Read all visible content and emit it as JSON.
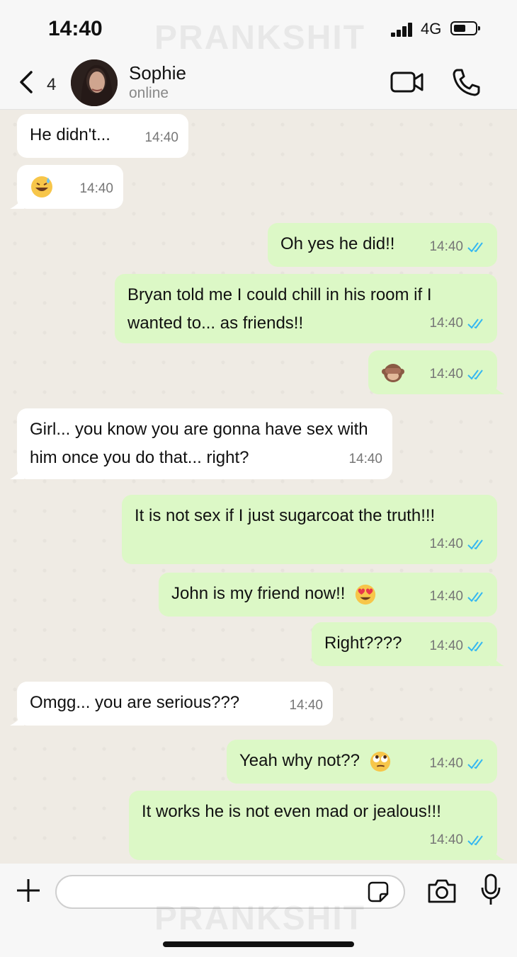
{
  "status_bar": {
    "time": "14:40",
    "network": "4G"
  },
  "watermark": "PRANKSHIT",
  "header": {
    "back_count": "4",
    "contact_name": "Sophie",
    "contact_status": "online"
  },
  "messages": [
    {
      "dir": "in",
      "text": "He didn't...",
      "time": "14:40"
    },
    {
      "dir": "in",
      "text": "",
      "emoji": "grinning-sweat-emoji",
      "time": "14:40"
    },
    {
      "dir": "out",
      "text": "Oh yes he did!!",
      "time": "14:40"
    },
    {
      "dir": "out",
      "text": "Bryan told me I could chill in his room if I wanted to... as friends!!",
      "time": "14:40"
    },
    {
      "dir": "out",
      "text": "",
      "emoji": "see-no-evil-monkey-emoji",
      "time": "14:40"
    },
    {
      "dir": "in",
      "text": "Girl... you know you are gonna have sex with him once you do that... right?",
      "time": "14:40"
    },
    {
      "dir": "out",
      "text": "It is not sex if I just sugarcoat the truth!!!",
      "time": "14:40"
    },
    {
      "dir": "out",
      "text": "John is my friend now!!",
      "emoji": "heart-eyes-emoji",
      "time": "14:40"
    },
    {
      "dir": "out",
      "text": "Right????",
      "time": "14:40"
    },
    {
      "dir": "in",
      "text": "Omgg... you are serious???",
      "time": "14:40"
    },
    {
      "dir": "out",
      "text": "Yeah why not??",
      "emoji": "rolling-eyes-emoji",
      "time": "14:40"
    },
    {
      "dir": "out",
      "text": "It works he is not even mad or jealous!!!",
      "time": "14:40"
    }
  ],
  "composer": {
    "placeholder": ""
  },
  "colors": {
    "incoming": "#ffffff",
    "outgoing": "#dcf8c6",
    "read_ticks": "#34b7f1"
  }
}
